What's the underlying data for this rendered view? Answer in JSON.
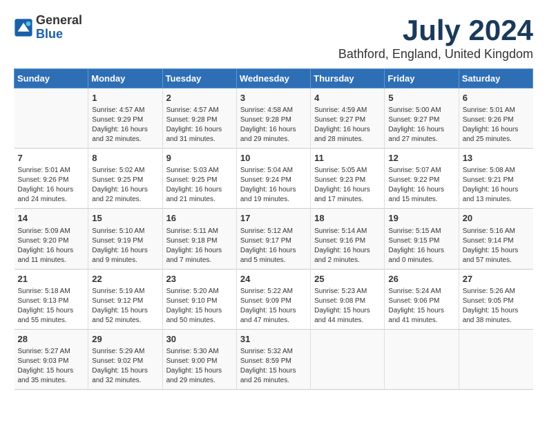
{
  "header": {
    "logo_general": "General",
    "logo_blue": "Blue",
    "month": "July 2024",
    "location": "Bathford, England, United Kingdom"
  },
  "days_of_week": [
    "Sunday",
    "Monday",
    "Tuesday",
    "Wednesday",
    "Thursday",
    "Friday",
    "Saturday"
  ],
  "weeks": [
    [
      {
        "day": "",
        "info": ""
      },
      {
        "day": "1",
        "info": "Sunrise: 4:57 AM\nSunset: 9:29 PM\nDaylight: 16 hours\nand 32 minutes."
      },
      {
        "day": "2",
        "info": "Sunrise: 4:57 AM\nSunset: 9:28 PM\nDaylight: 16 hours\nand 31 minutes."
      },
      {
        "day": "3",
        "info": "Sunrise: 4:58 AM\nSunset: 9:28 PM\nDaylight: 16 hours\nand 29 minutes."
      },
      {
        "day": "4",
        "info": "Sunrise: 4:59 AM\nSunset: 9:27 PM\nDaylight: 16 hours\nand 28 minutes."
      },
      {
        "day": "5",
        "info": "Sunrise: 5:00 AM\nSunset: 9:27 PM\nDaylight: 16 hours\nand 27 minutes."
      },
      {
        "day": "6",
        "info": "Sunrise: 5:01 AM\nSunset: 9:26 PM\nDaylight: 16 hours\nand 25 minutes."
      }
    ],
    [
      {
        "day": "7",
        "info": "Sunrise: 5:01 AM\nSunset: 9:26 PM\nDaylight: 16 hours\nand 24 minutes."
      },
      {
        "day": "8",
        "info": "Sunrise: 5:02 AM\nSunset: 9:25 PM\nDaylight: 16 hours\nand 22 minutes."
      },
      {
        "day": "9",
        "info": "Sunrise: 5:03 AM\nSunset: 9:25 PM\nDaylight: 16 hours\nand 21 minutes."
      },
      {
        "day": "10",
        "info": "Sunrise: 5:04 AM\nSunset: 9:24 PM\nDaylight: 16 hours\nand 19 minutes."
      },
      {
        "day": "11",
        "info": "Sunrise: 5:05 AM\nSunset: 9:23 PM\nDaylight: 16 hours\nand 17 minutes."
      },
      {
        "day": "12",
        "info": "Sunrise: 5:07 AM\nSunset: 9:22 PM\nDaylight: 16 hours\nand 15 minutes."
      },
      {
        "day": "13",
        "info": "Sunrise: 5:08 AM\nSunset: 9:21 PM\nDaylight: 16 hours\nand 13 minutes."
      }
    ],
    [
      {
        "day": "14",
        "info": "Sunrise: 5:09 AM\nSunset: 9:20 PM\nDaylight: 16 hours\nand 11 minutes."
      },
      {
        "day": "15",
        "info": "Sunrise: 5:10 AM\nSunset: 9:19 PM\nDaylight: 16 hours\nand 9 minutes."
      },
      {
        "day": "16",
        "info": "Sunrise: 5:11 AM\nSunset: 9:18 PM\nDaylight: 16 hours\nand 7 minutes."
      },
      {
        "day": "17",
        "info": "Sunrise: 5:12 AM\nSunset: 9:17 PM\nDaylight: 16 hours\nand 5 minutes."
      },
      {
        "day": "18",
        "info": "Sunrise: 5:14 AM\nSunset: 9:16 PM\nDaylight: 16 hours\nand 2 minutes."
      },
      {
        "day": "19",
        "info": "Sunrise: 5:15 AM\nSunset: 9:15 PM\nDaylight: 16 hours\nand 0 minutes."
      },
      {
        "day": "20",
        "info": "Sunrise: 5:16 AM\nSunset: 9:14 PM\nDaylight: 15 hours\nand 57 minutes."
      }
    ],
    [
      {
        "day": "21",
        "info": "Sunrise: 5:18 AM\nSunset: 9:13 PM\nDaylight: 15 hours\nand 55 minutes."
      },
      {
        "day": "22",
        "info": "Sunrise: 5:19 AM\nSunset: 9:12 PM\nDaylight: 15 hours\nand 52 minutes."
      },
      {
        "day": "23",
        "info": "Sunrise: 5:20 AM\nSunset: 9:10 PM\nDaylight: 15 hours\nand 50 minutes."
      },
      {
        "day": "24",
        "info": "Sunrise: 5:22 AM\nSunset: 9:09 PM\nDaylight: 15 hours\nand 47 minutes."
      },
      {
        "day": "25",
        "info": "Sunrise: 5:23 AM\nSunset: 9:08 PM\nDaylight: 15 hours\nand 44 minutes."
      },
      {
        "day": "26",
        "info": "Sunrise: 5:24 AM\nSunset: 9:06 PM\nDaylight: 15 hours\nand 41 minutes."
      },
      {
        "day": "27",
        "info": "Sunrise: 5:26 AM\nSunset: 9:05 PM\nDaylight: 15 hours\nand 38 minutes."
      }
    ],
    [
      {
        "day": "28",
        "info": "Sunrise: 5:27 AM\nSunset: 9:03 PM\nDaylight: 15 hours\nand 35 minutes."
      },
      {
        "day": "29",
        "info": "Sunrise: 5:29 AM\nSunset: 9:02 PM\nDaylight: 15 hours\nand 32 minutes."
      },
      {
        "day": "30",
        "info": "Sunrise: 5:30 AM\nSunset: 9:00 PM\nDaylight: 15 hours\nand 29 minutes."
      },
      {
        "day": "31",
        "info": "Sunrise: 5:32 AM\nSunset: 8:59 PM\nDaylight: 15 hours\nand 26 minutes."
      },
      {
        "day": "",
        "info": ""
      },
      {
        "day": "",
        "info": ""
      },
      {
        "day": "",
        "info": ""
      }
    ]
  ]
}
